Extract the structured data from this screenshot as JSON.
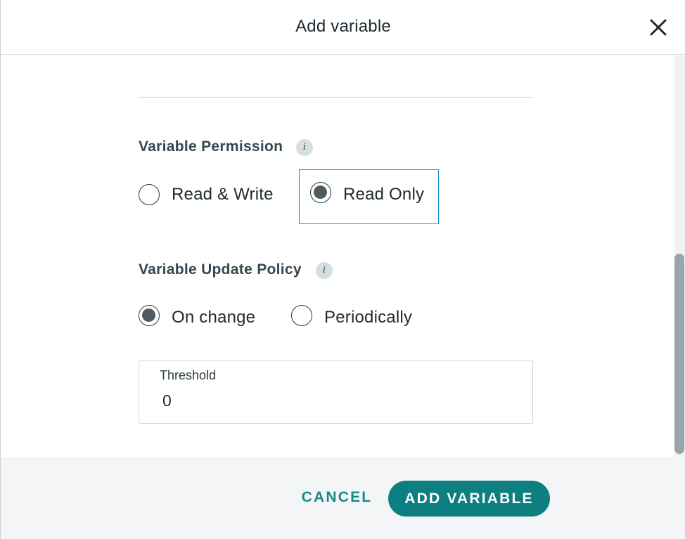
{
  "dialog": {
    "title": "Add variable",
    "close_icon": "close-icon"
  },
  "permission": {
    "label": "Variable Permission",
    "info_glyph": "i",
    "options": [
      {
        "label": "Read & Write",
        "checked": false
      },
      {
        "label": "Read Only",
        "checked": true
      }
    ]
  },
  "update_policy": {
    "label": "Variable Update Policy",
    "info_glyph": "i",
    "options": [
      {
        "label": "On change",
        "checked": true
      },
      {
        "label": "Periodically",
        "checked": false
      }
    ]
  },
  "threshold": {
    "label": "Threshold",
    "value": "0"
  },
  "footer": {
    "cancel_label": "CANCEL",
    "add_label": "ADD VARIABLE"
  },
  "colors": {
    "accent": "#0e7f80",
    "focus": "#1a8fc9",
    "radio_fill": "#4e5b63"
  }
}
